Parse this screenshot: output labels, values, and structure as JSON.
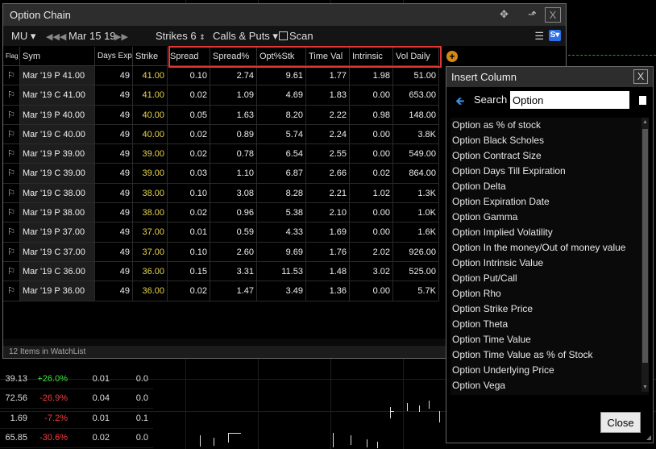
{
  "option_chain": {
    "title": "Option Chain",
    "toolbar": {
      "symbol": "MU",
      "date": "Mar 15 19",
      "strikes_label": "Strikes 6",
      "calls_puts": "Calls & Puts",
      "scan": "Scan"
    },
    "columns": [
      "Flag",
      "Sym",
      "Days Exp",
      "Strike",
      "Spread",
      "Spread%",
      "Opt%Stk",
      "Time Val",
      "Intrinsic",
      "Vol  Daily"
    ],
    "rows": [
      {
        "sym": "Mar '19 P 41.00",
        "days": "49",
        "strike": "41.00",
        "spread": "0.10",
        "spread_pct": "2.74",
        "opt_stk": "9.61",
        "time_val": "1.77",
        "intrinsic": "1.98",
        "vol": "51.00"
      },
      {
        "sym": "Mar '19 C 41.00",
        "days": "49",
        "strike": "41.00",
        "spread": "0.02",
        "spread_pct": "1.09",
        "opt_stk": "4.69",
        "time_val": "1.83",
        "intrinsic": "0.00",
        "vol": "653.00"
      },
      {
        "sym": "Mar '19 P 40.00",
        "days": "49",
        "strike": "40.00",
        "spread": "0.05",
        "spread_pct": "1.63",
        "opt_stk": "8.20",
        "time_val": "2.22",
        "intrinsic": "0.98",
        "vol": "148.00"
      },
      {
        "sym": "Mar '19 C 40.00",
        "days": "49",
        "strike": "40.00",
        "spread": "0.02",
        "spread_pct": "0.89",
        "opt_stk": "5.74",
        "time_val": "2.24",
        "intrinsic": "0.00",
        "vol": "3.8K"
      },
      {
        "sym": "Mar '19 P 39.00",
        "days": "49",
        "strike": "39.00",
        "spread": "0.02",
        "spread_pct": "0.78",
        "opt_stk": "6.54",
        "time_val": "2.55",
        "intrinsic": "0.00",
        "vol": "549.00"
      },
      {
        "sym": "Mar '19 C 39.00",
        "days": "49",
        "strike": "39.00",
        "spread": "0.03",
        "spread_pct": "1.10",
        "opt_stk": "6.87",
        "time_val": "2.66",
        "intrinsic": "0.02",
        "vol": "864.00"
      },
      {
        "sym": "Mar '19 C 38.00",
        "days": "49",
        "strike": "38.00",
        "spread": "0.10",
        "spread_pct": "3.08",
        "opt_stk": "8.28",
        "time_val": "2.21",
        "intrinsic": "1.02",
        "vol": "1.3K"
      },
      {
        "sym": "Mar '19 P 38.00",
        "days": "49",
        "strike": "38.00",
        "spread": "0.02",
        "spread_pct": "0.96",
        "opt_stk": "5.38",
        "time_val": "2.10",
        "intrinsic": "0.00",
        "vol": "1.0K"
      },
      {
        "sym": "Mar '19 P 37.00",
        "days": "49",
        "strike": "37.00",
        "spread": "0.01",
        "spread_pct": "0.59",
        "opt_stk": "4.33",
        "time_val": "1.69",
        "intrinsic": "0.00",
        "vol": "1.6K"
      },
      {
        "sym": "Mar '19 C 37.00",
        "days": "49",
        "strike": "37.00",
        "spread": "0.10",
        "spread_pct": "2.60",
        "opt_stk": "9.69",
        "time_val": "1.76",
        "intrinsic": "2.02",
        "vol": "926.00"
      },
      {
        "sym": "Mar '19 C 36.00",
        "days": "49",
        "strike": "36.00",
        "spread": "0.15",
        "spread_pct": "3.31",
        "opt_stk": "11.53",
        "time_val": "1.48",
        "intrinsic": "3.02",
        "vol": "525.00"
      },
      {
        "sym": "Mar '19 P 36.00",
        "days": "49",
        "strike": "36.00",
        "spread": "0.02",
        "spread_pct": "1.47",
        "opt_stk": "3.49",
        "time_val": "1.36",
        "intrinsic": "0.00",
        "vol": "5.7K"
      }
    ],
    "status": "12 Items in WatchList"
  },
  "insert_column": {
    "title": "Insert Column",
    "search_label": "Search",
    "search_value": "Option",
    "items": [
      "Option as % of stock",
      "Option Black Scholes",
      "Option Contract Size",
      "Option Days Till Expiration",
      "Option Delta",
      "Option Expiration Date",
      "Option Gamma",
      "Option Implied Volatility",
      "Option In the money/Out of money value",
      "Option Intrinsic Value",
      "Option Put/Call",
      "Option Rho",
      "Option Strike Price",
      "Option Theta",
      "Option Time Value",
      "Option Time Value as % of Stock",
      "Option Underlying Price",
      "Option Vega"
    ],
    "close_label": "Close"
  },
  "background": {
    "rows": [
      {
        "a": "39.13",
        "b": "+26.0%",
        "c": "0.01",
        "d": "0.0",
        "dir": "pos"
      },
      {
        "a": "72.56",
        "b": "-26.9%",
        "c": "0.04",
        "d": "0.0",
        "dir": "neg"
      },
      {
        "a": "1.69",
        "b": "-7.2%",
        "c": "0.01",
        "d": "0.1",
        "dir": "neg"
      },
      {
        "a": "65.85",
        "b": "-30.6%",
        "c": "0.02",
        "d": "0.0",
        "dir": "neg"
      }
    ]
  },
  "colors": {
    "strike": "#e8d44d",
    "highlight_box": "#e33636",
    "positive": "#3fe23f",
    "negative": "#ff3b3b",
    "accent": "#2a6ee8"
  }
}
